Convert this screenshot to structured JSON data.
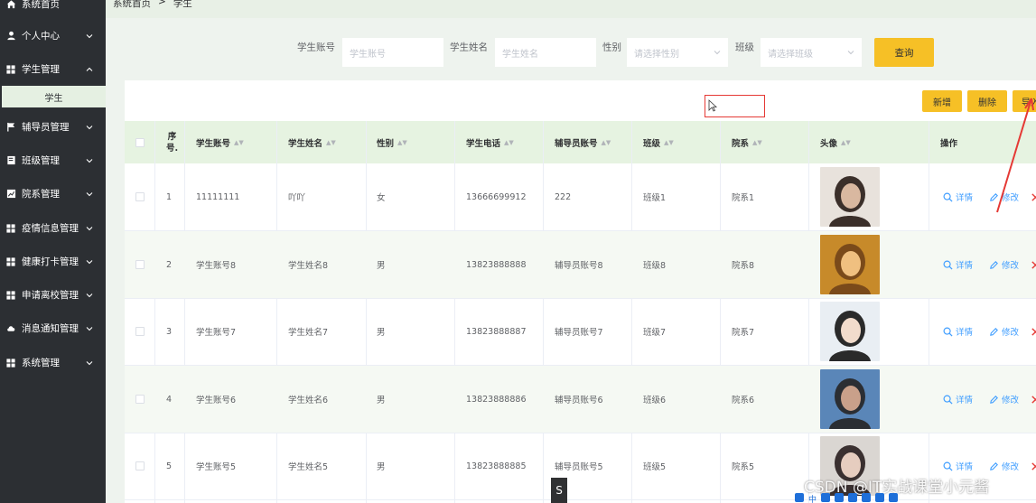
{
  "sidebar": {
    "items": [
      {
        "label": "系统首页",
        "icon": "home-icon",
        "expandable": false
      },
      {
        "label": "个人中心",
        "icon": "user-icon",
        "expandable": true
      },
      {
        "label": "学生管理",
        "icon": "grid-icon",
        "expandable": true,
        "expanded": true
      },
      {
        "label": "辅导员管理",
        "icon": "flag-icon",
        "expandable": true
      },
      {
        "label": "班级管理",
        "icon": "book-icon",
        "expandable": true
      },
      {
        "label": "院系管理",
        "icon": "chart-icon",
        "expandable": true
      },
      {
        "label": "疫情信息管理",
        "icon": "grid-icon",
        "expandable": true
      },
      {
        "label": "健康打卡管理",
        "icon": "grid-icon",
        "expandable": true
      },
      {
        "label": "申请离校管理",
        "icon": "grid-icon",
        "expandable": true
      },
      {
        "label": "消息通知管理",
        "icon": "cloud-icon",
        "expandable": true
      },
      {
        "label": "系统管理",
        "icon": "grid-icon",
        "expandable": true
      }
    ],
    "sub_item": "学生"
  },
  "breadcrumb": {
    "home": "系统首页",
    "sep": ">",
    "current": "学生"
  },
  "search": {
    "account_label": "学生账号",
    "account_placeholder": "学生账号",
    "name_label": "学生姓名",
    "name_placeholder": "学生姓名",
    "gender_label": "性别",
    "gender_placeholder": "请选择性别",
    "class_label": "班级",
    "class_placeholder": "请选择班级",
    "query_button": "查询"
  },
  "toolbar": {
    "add": "新增",
    "delete": "删除",
    "import": "导入"
  },
  "table": {
    "headers": {
      "index_top": "序",
      "index_bottom": "号.",
      "account": "学生账号",
      "name": "学生姓名",
      "gender": "性别",
      "phone": "学生电话",
      "counselor": "辅导员账号",
      "class": "班级",
      "department": "院系",
      "avatar": "头像",
      "actions": "操作"
    },
    "actions": {
      "detail": "详情",
      "edit": "修改"
    },
    "rows": [
      {
        "index": "1",
        "account": "11111111",
        "name": "吖吖",
        "gender": "女",
        "phone": "13666699912",
        "counselor": "222",
        "class": "班级1",
        "department": "院系1"
      },
      {
        "index": "2",
        "account": "学生账号8",
        "name": "学生姓名8",
        "gender": "男",
        "phone": "13823888888",
        "counselor": "辅导员账号8",
        "class": "班级8",
        "department": "院系8"
      },
      {
        "index": "3",
        "account": "学生账号7",
        "name": "学生姓名7",
        "gender": "男",
        "phone": "13823888887",
        "counselor": "辅导员账号7",
        "class": "班级7",
        "department": "院系7"
      },
      {
        "index": "4",
        "account": "学生账号6",
        "name": "学生姓名6",
        "gender": "男",
        "phone": "13823888886",
        "counselor": "辅导员账号6",
        "class": "班级6",
        "department": "院系6"
      },
      {
        "index": "5",
        "account": "学生账号5",
        "name": "学生姓名5",
        "gender": "男",
        "phone": "13823888885",
        "counselor": "辅导员账号5",
        "class": "班级5",
        "department": "院系5"
      }
    ]
  },
  "watermark": "CSDN @IT实战课堂小元酱",
  "overlay_badge": "S",
  "colors": {
    "sidebar": "#2c2f33",
    "accent": "#f6c026",
    "header_bg": "#e6f3e1",
    "link": "#409eff",
    "danger": "#e53935"
  }
}
